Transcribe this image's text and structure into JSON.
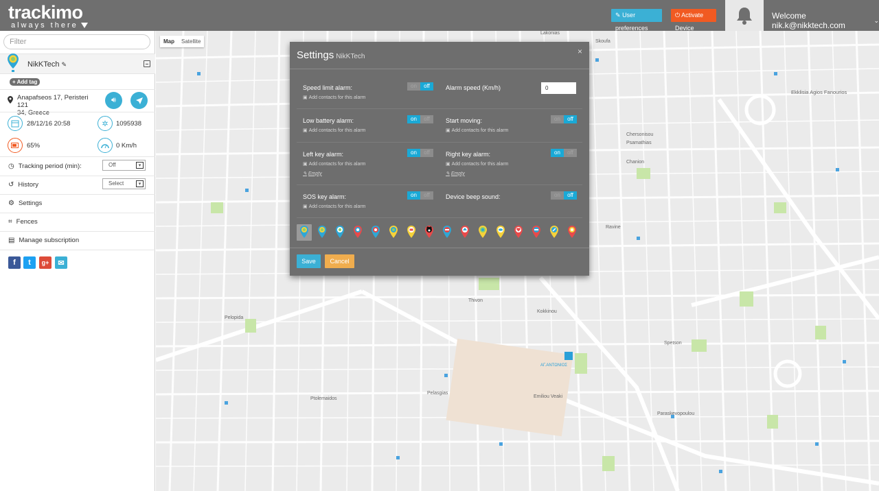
{
  "header": {
    "logo_text": "trackimo",
    "logo_tagline": "always there",
    "user_preferences": "User preferences",
    "activate_device": "Activate Device",
    "welcome": "Welcome nik.k@nikktech.com"
  },
  "sidebar": {
    "filter_placeholder": "Filter",
    "device_name": "NikKTech",
    "add_tag": "+ Add tag",
    "address_line1": "Anapafseos 17, Peristeri 121",
    "address_line2": "34, Greece",
    "datetime": "28/12/16 20:58",
    "device_id": "1095938",
    "battery": "65%",
    "speed": "0 Km/h",
    "tracking_period_label": "Tracking period (min):",
    "tracking_period_value": "Off",
    "history_label": "History",
    "history_value": "Select",
    "settings_label": "Settings",
    "fences_label": "Fences",
    "manage_subscription_label": "Manage subscription",
    "social": [
      "f",
      "t",
      "g+",
      "✉"
    ]
  },
  "map": {
    "tab_map": "Map",
    "tab_satellite": "Satellite",
    "labels": [
      {
        "text": "Lakonias"
      },
      {
        "text": "Skoufa"
      },
      {
        "text": "Ekklisia Agios Fanourios"
      },
      {
        "text": "Chersonisou"
      },
      {
        "text": "Psamathias"
      },
      {
        "text": "Chanion"
      },
      {
        "text": "Pelopida"
      },
      {
        "text": "Pelasgias"
      },
      {
        "text": "Thivon"
      },
      {
        "text": "Paraskevopoulou"
      },
      {
        "text": "Spetson"
      },
      {
        "text": "Emiliou Veaki"
      },
      {
        "text": "Ptolemaidos"
      },
      {
        "text": "Kokkinou"
      },
      {
        "text": "Ravine"
      },
      {
        "text": "ΑΓ.ΑΝΤΩΝΙΟΣ"
      }
    ]
  },
  "modal": {
    "title": "Settings",
    "subtitle": "NikKTech",
    "close": "×",
    "add_contacts": "Add contacts for this alarm",
    "empty": "Empty",
    "on": "on",
    "off": "off",
    "speed_limit_label": "Speed limit alarm:",
    "alarm_speed_label": "Alarm speed (Km/h)",
    "alarm_speed_value": "0",
    "low_battery_label": "Low battery alarm:",
    "start_moving_label": "Start moving:",
    "left_key_label": "Left key alarm:",
    "right_key_label": "Right key alarm:",
    "sos_key_label": "SOS key alarm:",
    "beep_label": "Device beep sound:",
    "save": "Save",
    "cancel": "Cancel"
  },
  "colors": {
    "accent": "#1aa9d6",
    "header": "#6f6f6f",
    "activate": "#f15a22",
    "cancel": "#f0ad4e",
    "modal_bg": "#6e6e6e"
  }
}
